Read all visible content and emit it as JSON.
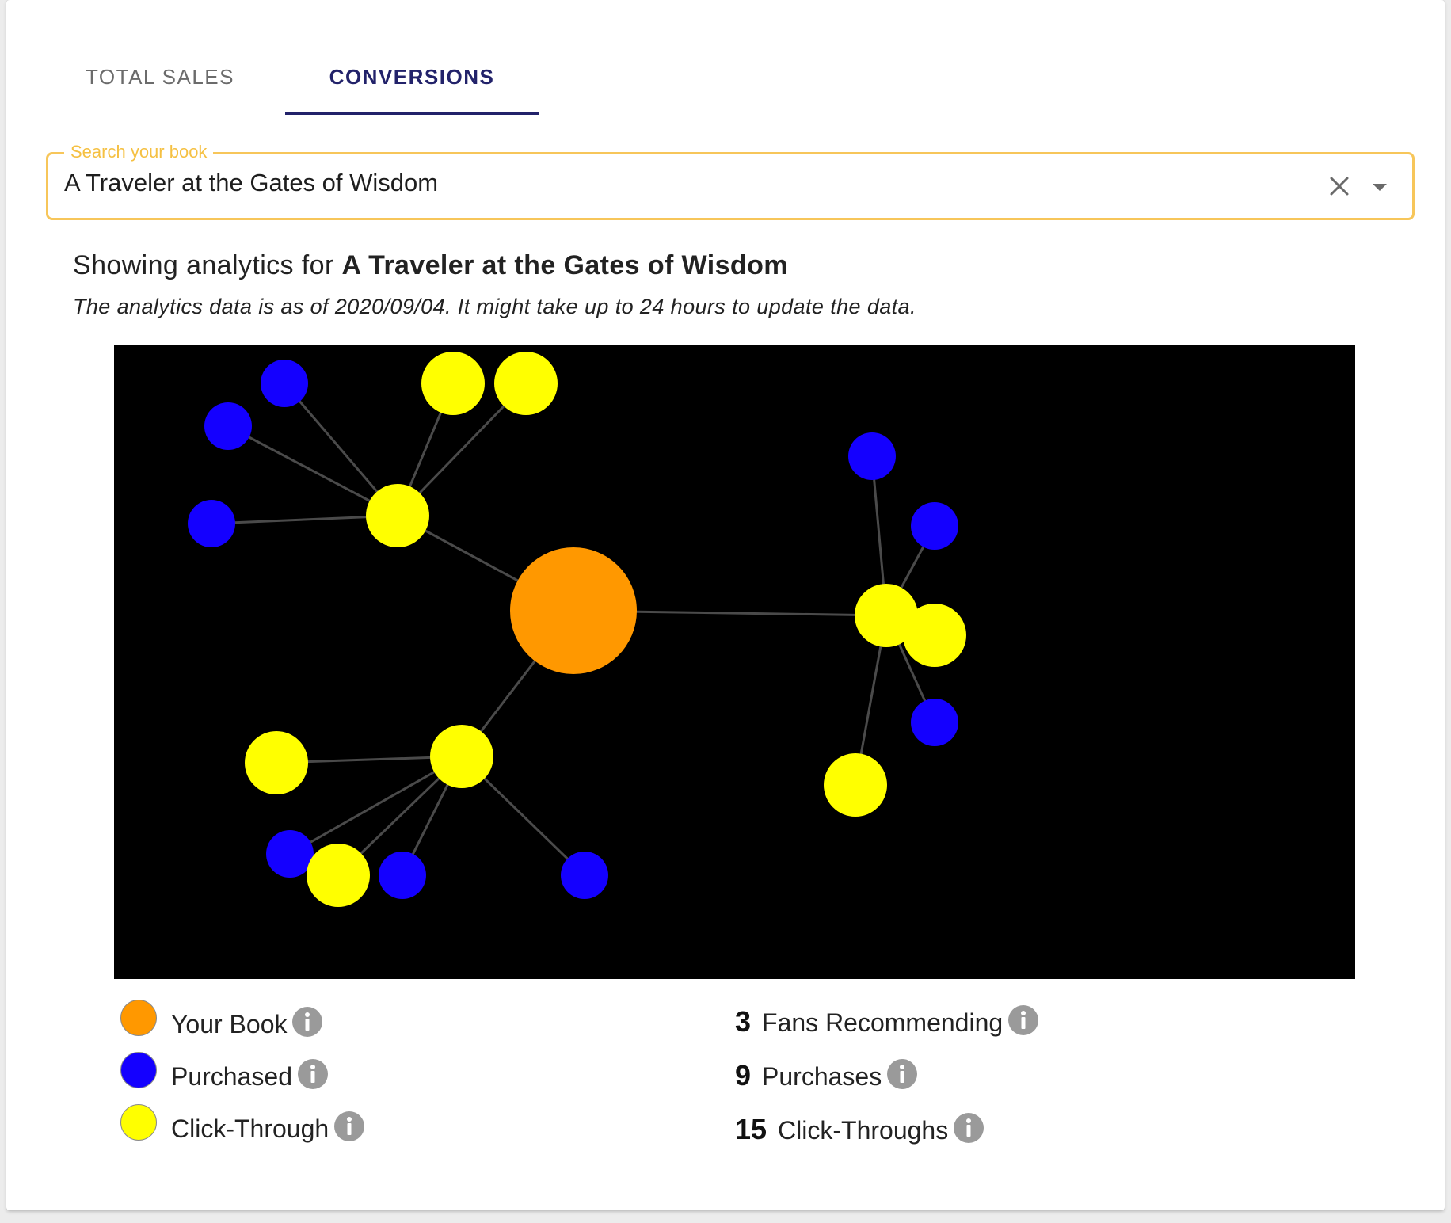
{
  "tabs": [
    {
      "label": "TOTAL SALES",
      "active": false
    },
    {
      "label": "CONVERSIONS",
      "active": true
    }
  ],
  "search": {
    "label": "Search your book",
    "value": "A Traveler at the Gates of Wisdom"
  },
  "heading": {
    "prefix": "Showing analytics for ",
    "book_title": "A Traveler at the Gates of Wisdom",
    "note": "The analytics data is as of 2020/09/04. It might take up to 24 hours to update the data."
  },
  "colors": {
    "your_book": "#ff9800",
    "purchased": "#1400ff",
    "click_through": "#ffff00",
    "edge": "#4a4a4a",
    "accent": "#22226a",
    "search_border": "#f7c65a"
  },
  "graph": {
    "nodes": [
      {
        "id": "book",
        "type": "your_book"
      },
      {
        "id": "fan1",
        "type": "click_through"
      },
      {
        "id": "fan2",
        "type": "click_through"
      },
      {
        "id": "fan3",
        "type": "click_through"
      },
      {
        "id": "a1",
        "type": "purchased"
      },
      {
        "id": "a2",
        "type": "purchased"
      },
      {
        "id": "a3",
        "type": "purchased"
      },
      {
        "id": "a4",
        "type": "click_through"
      },
      {
        "id": "a5",
        "type": "click_through"
      },
      {
        "id": "b1",
        "type": "purchased"
      },
      {
        "id": "b2",
        "type": "purchased"
      },
      {
        "id": "b3",
        "type": "click_through"
      },
      {
        "id": "b4",
        "type": "purchased"
      },
      {
        "id": "b5",
        "type": "click_through"
      },
      {
        "id": "c1",
        "type": "click_through"
      },
      {
        "id": "c2",
        "type": "purchased"
      },
      {
        "id": "c3",
        "type": "click_through"
      },
      {
        "id": "c4",
        "type": "purchased"
      },
      {
        "id": "c5",
        "type": "purchased"
      }
    ],
    "edges": [
      [
        "book",
        "fan1"
      ],
      [
        "book",
        "fan2"
      ],
      [
        "book",
        "fan3"
      ],
      [
        "fan1",
        "a1"
      ],
      [
        "fan1",
        "a2"
      ],
      [
        "fan1",
        "a3"
      ],
      [
        "fan1",
        "a4"
      ],
      [
        "fan1",
        "a5"
      ],
      [
        "fan2",
        "b1"
      ],
      [
        "fan2",
        "b2"
      ],
      [
        "fan2",
        "b3"
      ],
      [
        "fan2",
        "b4"
      ],
      [
        "fan2",
        "b5"
      ],
      [
        "fan3",
        "c1"
      ],
      [
        "fan3",
        "c2"
      ],
      [
        "fan3",
        "c3"
      ],
      [
        "fan3",
        "c4"
      ],
      [
        "fan3",
        "c5"
      ]
    ]
  },
  "legend": [
    {
      "type": "your_book",
      "label": "Your Book"
    },
    {
      "type": "purchased",
      "label": "Purchased"
    },
    {
      "type": "click_through",
      "label": "Click-Through"
    }
  ],
  "stats": [
    {
      "value": "3",
      "label": "Fans Recommending"
    },
    {
      "value": "9",
      "label": "Purchases"
    },
    {
      "value": "15",
      "label": "Click-Throughs"
    }
  ]
}
